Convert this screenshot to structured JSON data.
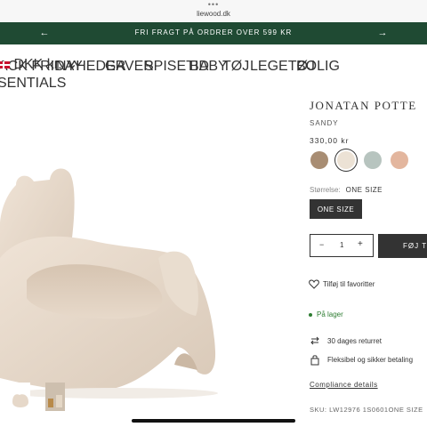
{
  "browser": {
    "dots": "•••",
    "url": "liewood.dk"
  },
  "announcement": {
    "text": "FRI FRAGT PÅ ORDRER OVER 599 KR",
    "prev_arrow": "←",
    "next_arrow": "→"
  },
  "nav": {
    "items": [
      "ACK FRIDAY",
      "NYHEDER",
      "GAVER",
      "SPISETID",
      "BABY",
      "TØJ",
      "LEGETØJ",
      "BOLIG",
      "SENTIALS"
    ],
    "currency": "DKK kr.",
    "currency_chevron": "⌄"
  },
  "product": {
    "title": "JONATAN POTTE",
    "variant": "SANDY",
    "price": "330,00 kr",
    "swatches": [
      {
        "name": "mustard-brown",
        "color": "#a88d73"
      },
      {
        "name": "sandy",
        "color": "#ece2d5",
        "selected": true
      },
      {
        "name": "sage",
        "color": "#b7c4bf"
      },
      {
        "name": "peach",
        "color": "#e3b69e"
      }
    ],
    "size_label": "Størrelse:",
    "size_value": "ONE SIZE",
    "size_option": "ONE SIZE",
    "quantity": {
      "minus": "−",
      "value": "1",
      "plus": "+"
    },
    "add_to_cart": "FØJ TIL",
    "favorite": "Tilføj til favoritter",
    "stock": "På lager",
    "returns": "30 dages returret",
    "payment": "Fleksibel og sikker betaling",
    "compliance": "Compliance details",
    "sku": "SKU: LW12976 1S0601ONE SIZE"
  }
}
